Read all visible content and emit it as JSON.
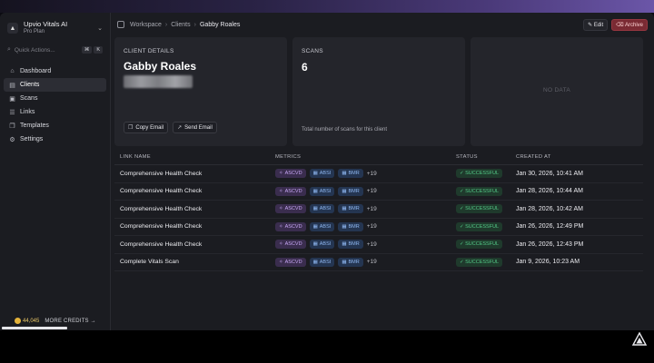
{
  "org": {
    "name": "Upvio Vitals AI",
    "plan": "Pro Plan"
  },
  "quick_actions": {
    "label": "Quick Actions...",
    "kbd1": "⌘",
    "kbd2": "K"
  },
  "nav": [
    {
      "label": "Dashboard",
      "icon": "dashboard-icon",
      "active": false
    },
    {
      "label": "Clients",
      "icon": "clients-icon",
      "active": true
    },
    {
      "label": "Scans",
      "icon": "scans-icon",
      "active": false
    },
    {
      "label": "Links",
      "icon": "links-icon",
      "active": false
    },
    {
      "label": "Templates",
      "icon": "templates-icon",
      "active": false
    },
    {
      "label": "Settings",
      "icon": "settings-icon",
      "active": false
    }
  ],
  "credits": {
    "amount": "44,045",
    "more_label": "MORE CREDITS →"
  },
  "breadcrumb": {
    "workspace": "Workspace",
    "clients": "Clients",
    "current": "Gabby Roales"
  },
  "actions": {
    "edit": "✎ Edit",
    "archive": "⌫ Archive"
  },
  "client_card": {
    "title": "CLIENT DETAILS",
    "name": "Gabby Roales",
    "copy_email": "Copy Email",
    "send_email": "Send Email"
  },
  "scans_card": {
    "title": "SCANS",
    "count": "6",
    "footer": "Total number of scans for this client"
  },
  "empty_card": {
    "label": "NO DATA"
  },
  "table": {
    "headers": {
      "link_name": "LINK NAME",
      "metrics": "METRICS",
      "status": "STATUS",
      "created_at": "CREATED AT"
    },
    "rows": [
      {
        "name": "Comprehensive Health Check",
        "m1": "ASCVD",
        "m2": "ABSI",
        "m3": "BMR",
        "more": "+19",
        "status": "✓ SUCCESSFUL",
        "created": "Jan 30, 2026, 10:41 AM"
      },
      {
        "name": "Comprehensive Health Check",
        "m1": "ASCVD",
        "m2": "ABSI",
        "m3": "BMR",
        "more": "+19",
        "status": "✓ SUCCESSFUL",
        "created": "Jan 28, 2026, 10:44 AM"
      },
      {
        "name": "Comprehensive Health Check",
        "m1": "ASCVD",
        "m2": "ABSI",
        "m3": "BMR",
        "more": "+19",
        "status": "✓ SUCCESSFUL",
        "created": "Jan 28, 2026, 10:42 AM"
      },
      {
        "name": "Comprehensive Health Check",
        "m1": "ASCVD",
        "m2": "ABSI",
        "m3": "BMR",
        "more": "+19",
        "status": "✓ SUCCESSFUL",
        "created": "Jan 26, 2026, 12:49 PM"
      },
      {
        "name": "Comprehensive Health Check",
        "m1": "ASCVD",
        "m2": "ABSI",
        "m3": "BMR",
        "more": "+19",
        "status": "✓ SUCCESSFUL",
        "created": "Jan 26, 2026, 12:43 PM"
      },
      {
        "name": "Complete Vitals Scan",
        "m1": "ASCVD",
        "m2": "ABSI",
        "m3": "BMR",
        "more": "+19",
        "status": "✓ SUCCESSFUL",
        "created": "Jan 9, 2026, 10:23 AM"
      }
    ]
  },
  "colors": {
    "accent_archive": "#7a2a33",
    "success": "#53c987",
    "ascvd": "#c7a6f5",
    "metric_blue": "#8fb8f2",
    "credit_gold": "#e4b23a"
  }
}
